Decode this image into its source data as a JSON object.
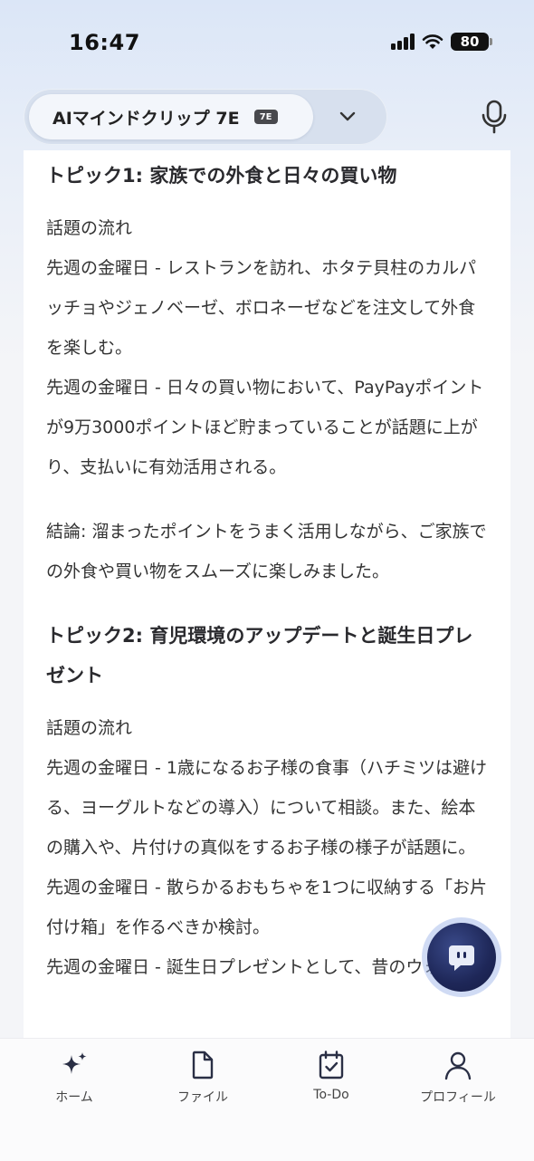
{
  "status_bar": {
    "time": "16:47",
    "battery": "80"
  },
  "header": {
    "model_name": "AIマインドクリップ 7E",
    "model_badge": "7E",
    "icons": [
      "chevron-down-icon",
      "microphone-icon"
    ]
  },
  "content": {
    "topic1": {
      "title": "トピック1: 家族での外食と日々の買い物",
      "flow_label": "話題の流れ",
      "item1": "先週の金曜日 - レストランを訪れ、ホタテ貝柱のカルパッチョやジェノベーゼ、ボロネーゼなどを注文して外食を楽しむ。",
      "item2": "先週の金曜日 - 日々の買い物において、PayPayポイントが9万3000ポイントほど貯まっていることが話題に上がり、支払いに有効活用される。",
      "conclusion": "結論: 溜まったポイントをうまく活用しながら、ご家族での外食や買い物をスムーズに楽しみました。"
    },
    "topic2": {
      "title": "トピック2: 育児環境のアップデートと誕生日プレゼント",
      "flow_label": "話題の流れ",
      "item1": "先週の金曜日 - 1歳になるお子様の食事（ハチミツは避ける、ヨーグルトなどの導入）について相談。また、絵本の購入や、片付けの真似をするお子様の様子が話題に。",
      "item2": "先週の金曜日 - 散らかるおもちゃを1つに収納する「お片付け箱」を作るべきか検討。",
      "item3": "先週の金曜日 - 誕生日プレゼントとして、昔のウォ"
    }
  },
  "bottom_nav": {
    "items": [
      {
        "label": "ホーム",
        "icon": "sparkle-icon"
      },
      {
        "label": "ファイル",
        "icon": "file-icon"
      },
      {
        "label": "To-Do",
        "icon": "calendar-check-icon"
      },
      {
        "label": "プロフィール",
        "icon": "person-icon"
      }
    ]
  },
  "colors": {
    "accent": "#1e2758",
    "text": "#2b2b2f",
    "background": "#f4f5f8"
  }
}
